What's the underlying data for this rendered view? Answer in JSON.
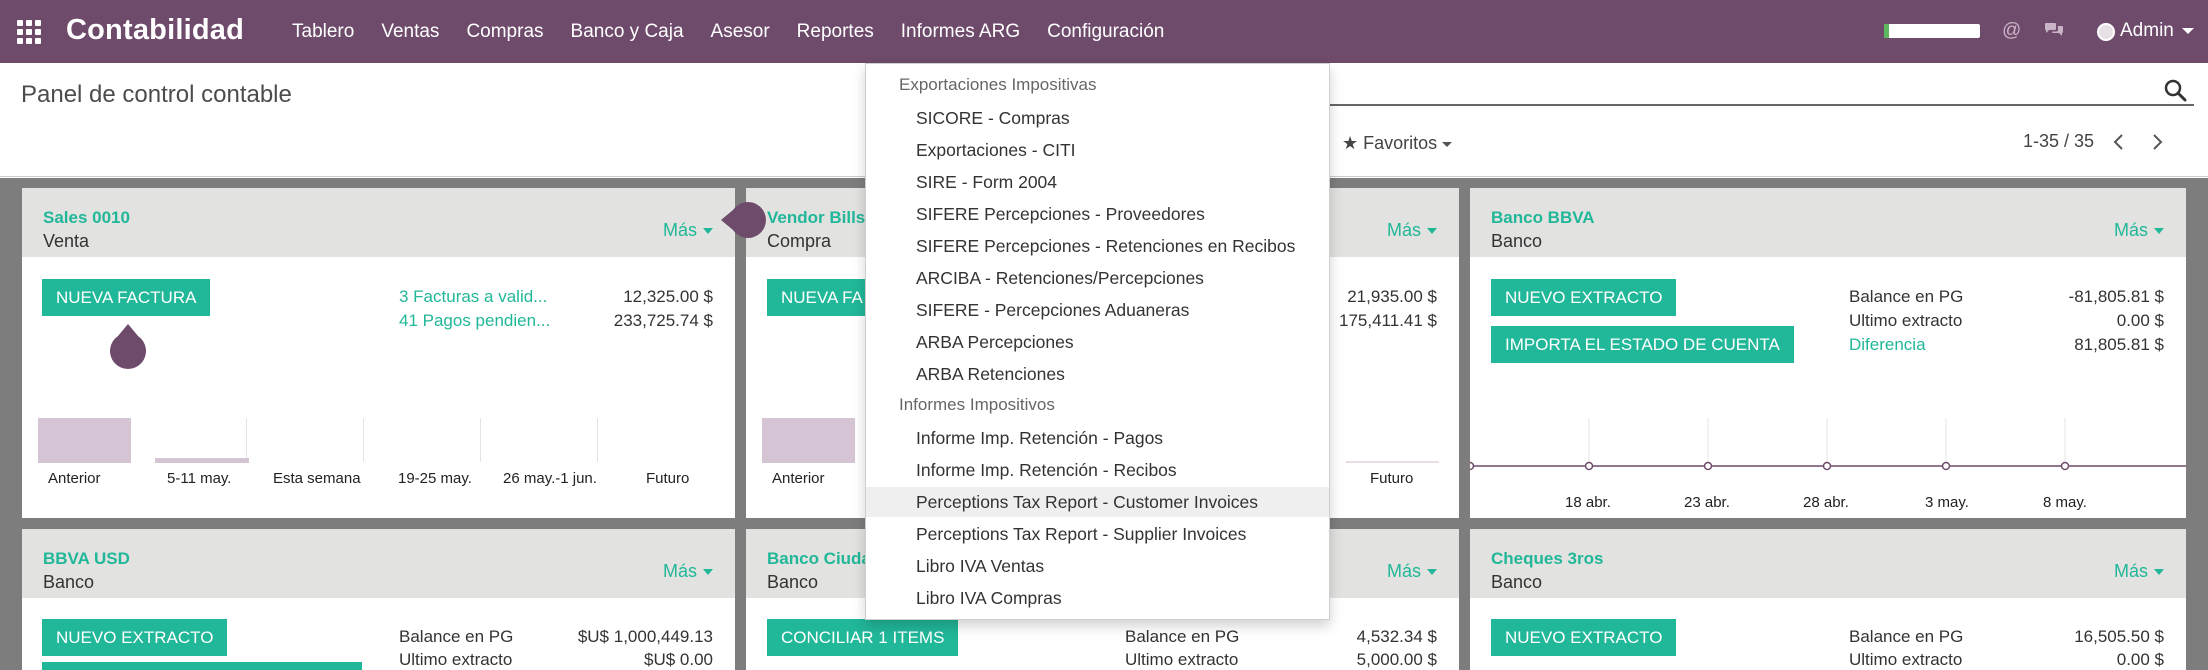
{
  "navbar": {
    "brand": "Contabilidad",
    "menu": [
      "Tablero",
      "Ventas",
      "Compras",
      "Banco y Caja",
      "Asesor",
      "Reportes",
      "Informes ARG",
      "Configuración"
    ],
    "user": "Admin",
    "progress_fraction": 0.05,
    "colors": {
      "bar": "#6e4a6b",
      "accent": "#21b799"
    }
  },
  "control_panel": {
    "title": "Panel de control contable",
    "favorites": "Favoritos",
    "pager": "1-35 / 35"
  },
  "dropdown": {
    "section1": "Exportaciones Impositivas",
    "items1": [
      "SICORE - Compras",
      "Exportaciones - CITI",
      "SIRE - Form 2004",
      "SIFERE Percepciones - Proveedores",
      "SIFERE Percepciones - Retenciones en Recibos",
      "ARCIBA - Retenciones/Percepciones",
      "SIFERE - Percepciones Aduaneras",
      "ARBA Percepciones",
      "ARBA Retenciones"
    ],
    "section2": "Informes Impositivos",
    "items2": [
      "Informe Imp. Retención - Pagos",
      "Informe Imp. Retención - Recibos",
      "Perceptions Tax Report - Customer Invoices",
      "Perceptions Tax Report - Supplier Invoices",
      "Libro IVA Ventas",
      "Libro IVA Compras"
    ]
  },
  "cards": {
    "mas": "Más",
    "sales": {
      "title": "Sales 0010",
      "sub": "Venta",
      "button": "NUEVA FACTURA",
      "link1": "3 Facturas a valid...",
      "val1": "12,325.00 $",
      "link2": "41 Pagos pendien...",
      "val2": "233,725.74 $",
      "axis": [
        "Anterior",
        "5-11 may.",
        "Esta semana",
        "19-25 may.",
        "26 may.-1 jun.",
        "Futuro"
      ]
    },
    "vendor": {
      "title": "Vendor Bills",
      "sub": "Compra",
      "button": "NUEVA FA",
      "val1": "21,935.00 $",
      "val2": "175,411.41 $",
      "axis_first": "Anterior",
      "axis_last": "Futuro"
    },
    "bbva": {
      "title": "Banco BBVA",
      "sub": "Banco",
      "button1": "NUEVO EXTRACTO",
      "button2": "IMPORTA EL ESTADO DE CUENTA",
      "label1": "Balance en PG",
      "val1": "-81,805.81 $",
      "label2": "Ultimo extracto",
      "val2": "0.00 $",
      "label3": "Diferencia",
      "val3": "81,805.81 $",
      "axis": [
        "18 abr.",
        "23 abr.",
        "28 abr.",
        "3 may.",
        "8 may."
      ]
    },
    "bbva_usd": {
      "title": "BBVA USD",
      "sub": "Banco",
      "button": "NUEVO EXTRACTO",
      "label1": "Balance en PG",
      "val1": "$U$ 1,000,449.13",
      "label2": "Ultimo extracto",
      "val2": "$U$ 0.00"
    },
    "ciudad": {
      "title": "Banco Ciuda",
      "sub": "Banco",
      "button": "CONCILIAR 1 ITEMS",
      "label1": "Balance en PG",
      "val1": "4,532.34 $",
      "label2": "Ultimo extracto",
      "val2": "5,000.00 $"
    },
    "cheques": {
      "title": "Cheques 3ros",
      "sub": "Banco",
      "button": "NUEVO EXTRACTO",
      "label1": "Balance en PG",
      "val1": "16,505.50 $",
      "label2": "Ultimo extracto",
      "val2": "0.00 $"
    }
  }
}
